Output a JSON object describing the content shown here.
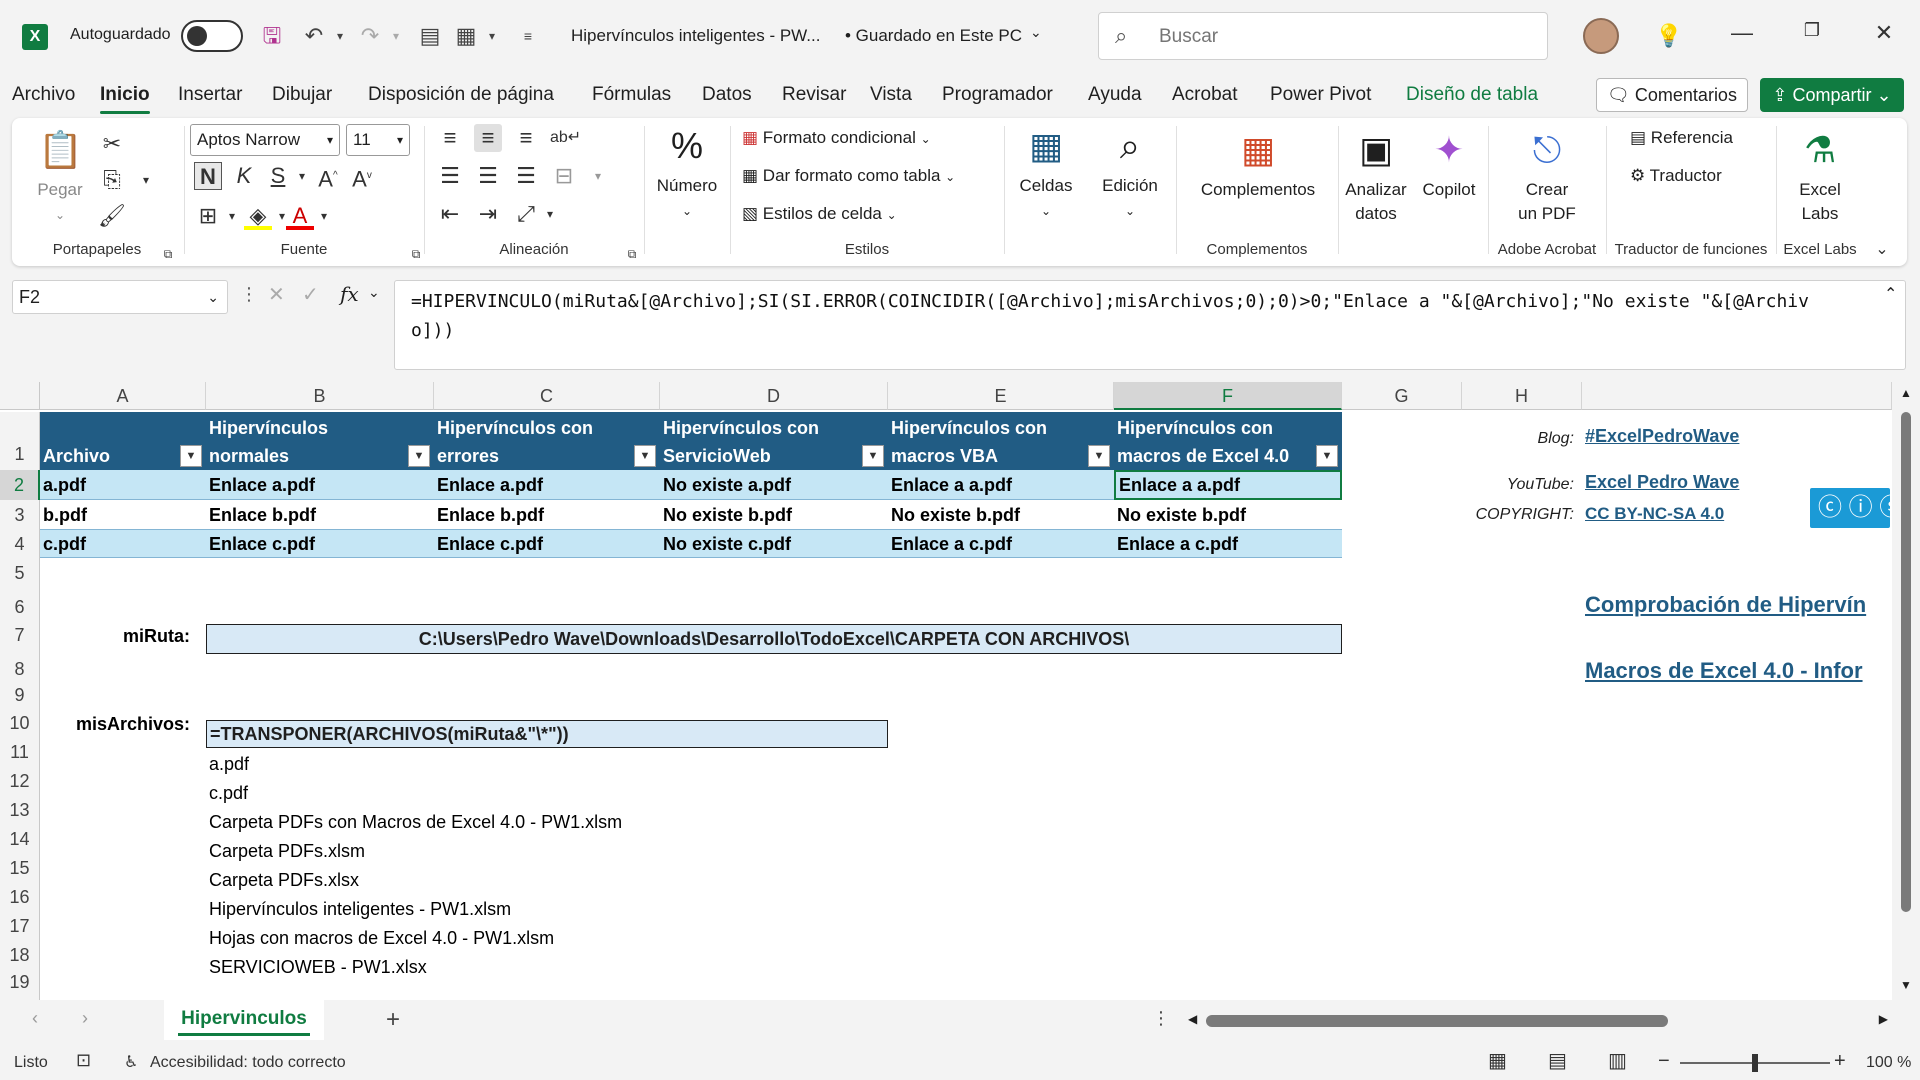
{
  "titlebar": {
    "autosave_label": "Autoguardado",
    "doc_title": "Hipervínculos inteligentes - PW...",
    "save_status": "• Guardado en Este PC",
    "search_placeholder": "Buscar"
  },
  "menu": {
    "tabs": [
      "Archivo",
      "Inicio",
      "Insertar",
      "Dibujar",
      "Disposición de página",
      "Fórmulas",
      "Datos",
      "Revisar",
      "Vista",
      "Programador",
      "Ayuda",
      "Acrobat",
      "Power Pivot",
      "Diseño de tabla"
    ],
    "comments_label": "Comentarios",
    "share_label": "Compartir"
  },
  "ribbon": {
    "clipboard": {
      "paste": "Pegar",
      "group": "Portapapeles"
    },
    "font": {
      "name": "Aptos Narrow",
      "size": "11",
      "bold": "N",
      "italic": "K",
      "underline": "S",
      "group": "Fuente"
    },
    "alignment": {
      "group": "Alineación"
    },
    "number": {
      "label": "Número"
    },
    "styles": {
      "cond_format": "Formato condicional",
      "table_format": "Dar formato como tabla",
      "cell_styles": "Estilos de celda",
      "group": "Estilos"
    },
    "cells": {
      "label": "Celdas"
    },
    "editing": {
      "label": "Edición"
    },
    "addins": {
      "label": "Complementos",
      "group": "Complementos"
    },
    "analyze": {
      "label1": "Analizar",
      "label2": "datos"
    },
    "copilot": {
      "label": "Copilot"
    },
    "acrobat": {
      "label1": "Crear",
      "label2": "un PDF",
      "group": "Adobe Acrobat"
    },
    "translator": {
      "reference": "Referencia",
      "translator": "Traductor",
      "group": "Traductor de funciones"
    },
    "labs": {
      "label1": "Excel",
      "label2": "Labs",
      "group": "Excel Labs"
    }
  },
  "formula_bar": {
    "name_box": "F2",
    "fx": "fx",
    "formula": "=HIPERVINCULO(miRuta&[@Archivo];SI(SI.ERROR(COINCIDIR([@Archivo];misArchivos;0);0)>0;\"Enlace a \"&[@Archivo];\"No existe \"&[@Archivo]))"
  },
  "grid": {
    "columns": [
      "A",
      "B",
      "C",
      "D",
      "E",
      "F",
      "G",
      "H"
    ],
    "rows": [
      "1",
      "2",
      "3",
      "4",
      "5",
      "6",
      "7",
      "8",
      "9",
      "10",
      "11",
      "12",
      "13",
      "14",
      "15",
      "16",
      "17",
      "18",
      "19"
    ],
    "table_headers": [
      "Archivo",
      "Hipervínculos normales",
      "Hipervínculos con errores",
      "Hipervínculos con ServicioWeb",
      "Hipervínculos con macros VBA",
      "Hipervínculos con macros de Excel 4.0"
    ],
    "table_rows": [
      [
        "a.pdf",
        "Enlace a.pdf",
        "Enlace a.pdf",
        "No existe a.pdf",
        "Enlace a a.pdf",
        "Enlace a a.pdf"
      ],
      [
        "b.pdf",
        "Enlace b.pdf",
        "Enlace b.pdf",
        "No existe b.pdf",
        "No existe b.pdf",
        "No existe b.pdf"
      ],
      [
        "c.pdf",
        "Enlace c.pdf",
        "Enlace c.pdf",
        "No existe c.pdf",
        "Enlace a c.pdf",
        "Enlace a c.pdf"
      ]
    ],
    "miruta_label": "miRuta:",
    "miruta_value": "C:\\Users\\Pedro Wave\\Downloads\\Desarrollo\\TodoExcel\\CARPETA CON ARCHIVOS\\",
    "misarchivos_label": "misArchivos:",
    "misarchivos_formula": "=TRANSPONER(ARCHIVOS(miRuta&\"\\*\"))",
    "file_list": [
      "a.pdf",
      "c.pdf",
      "Carpeta PDFs con Macros de Excel 4.0 - PW1.xlsm",
      "Carpeta PDFs.xlsm",
      "Carpeta PDFs.xlsx",
      "Hipervínculos inteligentes - PW1.xlsm",
      "Hojas con macros de Excel 4.0 - PW1.xlsm",
      "SERVICIOWEB - PW1.xlsx"
    ],
    "side": {
      "blog_label": "Blog:",
      "blog_link": "#ExcelPedroWave",
      "youtube_label": "YouTube:",
      "youtube_link": "Excel Pedro Wave",
      "copyright_label": "COPYRIGHT:",
      "copyright_link": "CC BY-NC-SA 4.0",
      "link1": "Comprobación de Hipervín",
      "link2": "Macros de Excel 4.0 - Infor"
    }
  },
  "sheets": {
    "active": "Hipervinculos"
  },
  "status": {
    "ready": "Listo",
    "accessibility": "Accesibilidad: todo correcto",
    "zoom": "100 %"
  }
}
